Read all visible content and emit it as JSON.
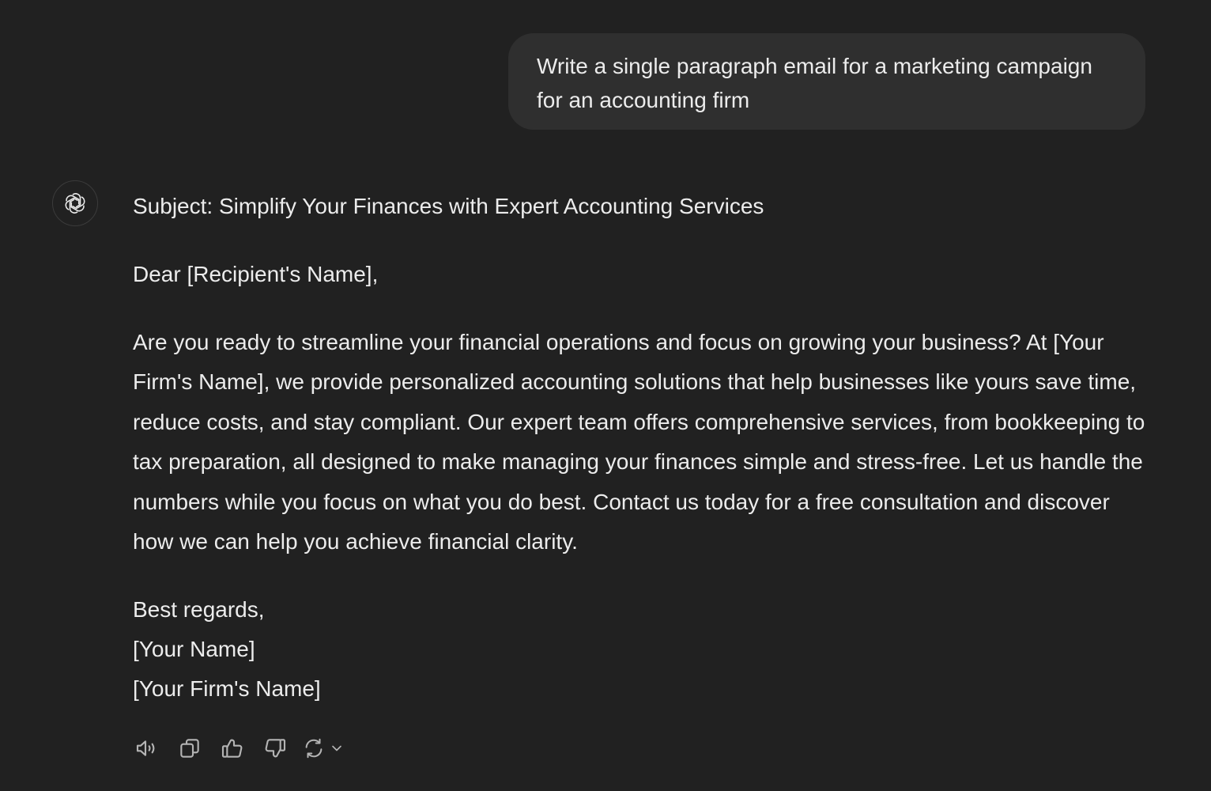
{
  "user_message": {
    "text": "Write a single paragraph email for a marketing campaign for an accounting firm"
  },
  "assistant": {
    "avatar_icon": "openai-logo-icon",
    "subject": "Subject: Simplify Your Finances with Expert Accounting Services",
    "greeting": "Dear [Recipient's Name],",
    "body": "Are you ready to streamline your financial operations and focus on growing your business? At [Your Firm's Name], we provide personalized accounting solutions that help businesses like yours save time, reduce costs, and stay compliant. Our expert team offers comprehensive services, from bookkeeping to tax preparation, all designed to make managing your finances simple and stress-free. Let us handle the numbers while you focus on what you do best. Contact us today for a free consultation and discover how we can help you achieve financial clarity.",
    "closing": "Best regards,",
    "signature_name": "[Your Name]",
    "signature_firm": "[Your Firm's Name]"
  },
  "actions": {
    "icons": [
      "read-aloud-icon",
      "copy-icon",
      "thumbs-up-icon",
      "thumbs-down-icon",
      "regenerate-icon",
      "chevron-down-icon"
    ]
  },
  "colors": {
    "background": "#212121",
    "user_bubble": "#2f2f2f",
    "text": "#ececec",
    "icon": "#b4b4b4"
  }
}
